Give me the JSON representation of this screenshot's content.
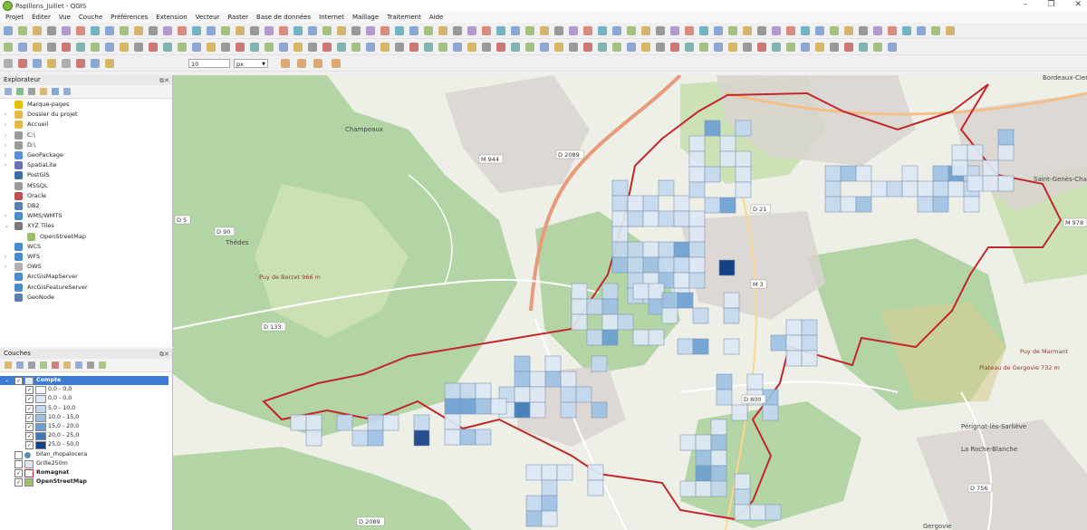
{
  "window": {
    "title": "Papillons_Juillet - QGIS",
    "minimize": "–",
    "maximize": "❐",
    "close": "✕"
  },
  "menu": [
    "Projet",
    "Éditer",
    "Vue",
    "Couche",
    "Préférences",
    "Extension",
    "Vecteur",
    "Raster",
    "Base de données",
    "Internet",
    "Maillage",
    "Traitement",
    "Aide"
  ],
  "digitize": {
    "value": "10",
    "unit": "px"
  },
  "browser": {
    "title": "Explorateur",
    "items": [
      {
        "label": "Marque-pages",
        "icon": "star-icon",
        "color": "#e8c000",
        "arrow": ""
      },
      {
        "label": "Dossier du projet",
        "icon": "folder-icon",
        "color": "#e6b94c",
        "arrow": "›"
      },
      {
        "label": "Accueil",
        "icon": "folder-icon",
        "color": "#e6b94c",
        "arrow": "›"
      },
      {
        "label": "C:\\",
        "icon": "drive-icon",
        "color": "#9a9a9a",
        "arrow": "›"
      },
      {
        "label": "D:\\",
        "icon": "drive-icon",
        "color": "#9a9a9a",
        "arrow": "›"
      },
      {
        "label": "GeoPackage",
        "icon": "geopackage-icon",
        "color": "#5b8fd6",
        "arrow": "›"
      },
      {
        "label": "SpatiaLite",
        "icon": "spatialite-icon",
        "color": "#6a6fb8",
        "arrow": "›"
      },
      {
        "label": "PostGIS",
        "icon": "postgis-icon",
        "color": "#3b6ea8",
        "arrow": ""
      },
      {
        "label": "MSSQL",
        "icon": "mssql-icon",
        "color": "#9a9a9a",
        "arrow": ""
      },
      {
        "label": "Oracle",
        "icon": "oracle-icon",
        "color": "#c0504d",
        "arrow": ""
      },
      {
        "label": "DB2",
        "icon": "db2-icon",
        "color": "#5b7fb0",
        "arrow": ""
      },
      {
        "label": "WMS/WMTS",
        "icon": "globe-icon",
        "color": "#4a8cc9",
        "arrow": "›"
      },
      {
        "label": "XYZ Tiles",
        "icon": "grid-icon",
        "color": "#7a7a7a",
        "arrow": "⌄"
      },
      {
        "label": "OpenStreetMap",
        "icon": "osm-icon",
        "color": "#9abe6a",
        "arrow": ""
      },
      {
        "label": "WCS",
        "icon": "globe-icon",
        "color": "#4a8cc9",
        "arrow": ""
      },
      {
        "label": "WFS",
        "icon": "globe-icon",
        "color": "#4a8cc9",
        "arrow": "›"
      },
      {
        "label": "OWS",
        "icon": "globe-icon",
        "color": "#b0b0b0",
        "arrow": "›"
      },
      {
        "label": "ArcGisMapServer",
        "icon": "arcgis-icon",
        "color": "#4a8cc9",
        "arrow": ""
      },
      {
        "label": "ArcGisFeatureServer",
        "icon": "arcgis-icon",
        "color": "#4a8cc9",
        "arrow": ""
      },
      {
        "label": "GeoNode",
        "icon": "geonode-icon",
        "color": "#5a7fae",
        "arrow": ""
      }
    ]
  },
  "layers": {
    "title": "Couches",
    "items": [
      {
        "label": "Compte",
        "kind": "group",
        "checked": true,
        "selected": true,
        "bold": true
      },
      {
        "label": "0,0 - 0,0",
        "kind": "class",
        "checked": true,
        "color": "#f3f7fc"
      },
      {
        "label": "0,0 - 0,0",
        "kind": "class",
        "checked": true,
        "color": "#dde8f4"
      },
      {
        "label": "5,0 - 10,0",
        "kind": "class",
        "checked": true,
        "color": "#c3d8ee"
      },
      {
        "label": "10,0 - 15,0",
        "kind": "class",
        "checked": true,
        "color": "#9dc1e3"
      },
      {
        "label": "15,0 - 20,0",
        "kind": "class",
        "checked": true,
        "color": "#6b9fd0"
      },
      {
        "label": "20,0 - 25,0",
        "kind": "class",
        "checked": true,
        "color": "#3f78b7"
      },
      {
        "label": "25,0 - 50,0",
        "kind": "class",
        "checked": true,
        "color": "#173f83"
      },
      {
        "label": "bilan_rhopalocera",
        "kind": "layer",
        "checked": false,
        "bold": false
      },
      {
        "label": "Grille250m",
        "kind": "layer",
        "checked": false,
        "bold": false
      },
      {
        "label": "Romagnat",
        "kind": "layer",
        "checked": true,
        "bold": true
      },
      {
        "label": "OpenStreetMap",
        "kind": "layer",
        "checked": true,
        "bold": true
      }
    ]
  },
  "map_labels": [
    {
      "text": "D 2089",
      "kind": "road"
    },
    {
      "text": "M 944",
      "kind": "road"
    },
    {
      "text": "D 21",
      "kind": "road"
    },
    {
      "text": "M 978",
      "kind": "road"
    },
    {
      "text": "D 133",
      "kind": "road"
    },
    {
      "text": "D 800",
      "kind": "road"
    },
    {
      "text": "D 756",
      "kind": "road"
    },
    {
      "text": "D 2089",
      "kind": "road"
    },
    {
      "text": "M 3",
      "kind": "road"
    },
    {
      "text": "D 5",
      "kind": "road"
    },
    {
      "text": "D 90",
      "kind": "road"
    },
    {
      "text": "Champeaux",
      "kind": "place"
    },
    {
      "text": "Thédes",
      "kind": "place"
    },
    {
      "text": "Saint-Genès-Champanelle",
      "kind": "place"
    },
    {
      "text": "Pérignat-lès-Sarliève",
      "kind": "place"
    },
    {
      "text": "Gergovie",
      "kind": "place"
    },
    {
      "text": "La Roche-Blanche",
      "kind": "place"
    },
    {
      "text": "Puy de Berzet 966 m",
      "kind": "peak"
    },
    {
      "text": "Puy de Marmant",
      "kind": "peak"
    },
    {
      "text": "Plateau de Gergovie 732 m",
      "kind": "peak"
    },
    {
      "text": "Bordeaux-Cler",
      "kind": "place"
    }
  ]
}
